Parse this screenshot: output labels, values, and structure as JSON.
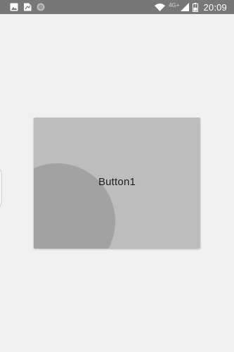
{
  "status_bar": {
    "left_icons": [
      "image-notification-icon",
      "file-notification-icon",
      "sync-notification-icon"
    ],
    "network_type": "4G+",
    "battery_level": "2",
    "time": "20:09"
  },
  "main": {
    "button_label": "Button1"
  },
  "colors": {
    "status_bar_bg": "#777777",
    "page_bg": "#f1f1f1",
    "button_bg": "#bdbdbd",
    "ripple": "#a2a2a2"
  }
}
